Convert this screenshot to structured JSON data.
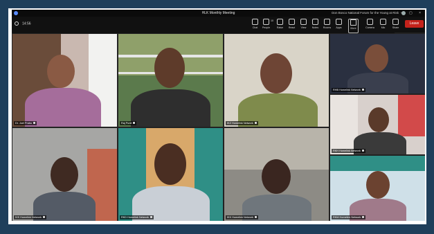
{
  "window": {
    "title": "HLK Monthly Meeting",
    "right_info": "Don Bosco National Forum for the Young at Risk",
    "controls": "– ▢ ×"
  },
  "toolbar": {
    "timer": "14:56",
    "buttons": [
      {
        "label": "Chat",
        "icon": "chat-icon"
      },
      {
        "label": "People",
        "icon": "people-icon",
        "count": "10"
      },
      {
        "label": "Raise",
        "icon": "raise-hand-icon"
      },
      {
        "label": "React",
        "icon": "react-icon"
      },
      {
        "label": "View",
        "icon": "view-icon"
      },
      {
        "label": "Notes",
        "icon": "notes-icon"
      },
      {
        "label": "Rooms",
        "icon": "rooms-icon"
      },
      {
        "label": "Apps",
        "icon": "apps-icon"
      },
      {
        "label": "More",
        "icon": "more-icon"
      },
      {
        "label": "Camera",
        "icon": "camera-icon"
      },
      {
        "label": "Mic",
        "icon": "mic-icon"
      },
      {
        "label": "Share",
        "icon": "share-icon"
      }
    ],
    "leave_label": "Leave"
  },
  "participants": [
    {
      "name": "Dr. Joel Prabu"
    },
    {
      "name": "Raj Punit"
    },
    {
      "name": "IKZ Homelink Network"
    },
    {
      "name": "RHB Homelink Network"
    },
    {
      "name": "RKH Homelink Network"
    },
    {
      "name": "IVK Homelink Network"
    },
    {
      "name": "RKD Homelink Network"
    },
    {
      "name": "IKK Homelink Network"
    },
    {
      "name": "RKM Homelink Network"
    }
  ],
  "colors": {
    "leave": "#c4221b",
    "page_bg": "#1f3f5b"
  }
}
